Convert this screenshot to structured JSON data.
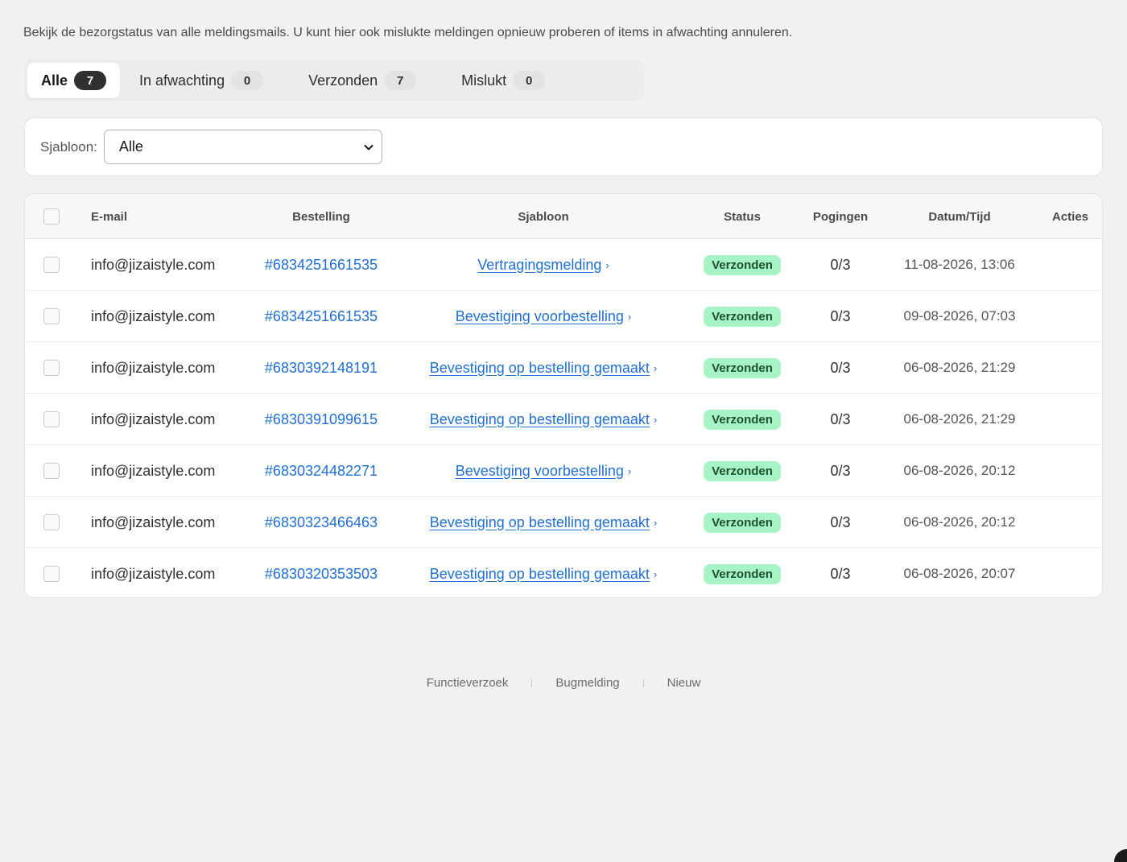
{
  "description": "Bekijk de bezorgstatus van alle meldingsmails. U kunt hier ook mislukte meldingen opnieuw proberen of items in afwachting annuleren.",
  "tabs": [
    {
      "label": "Alle",
      "count": "7",
      "active": true
    },
    {
      "label": "In afwachting",
      "count": "0",
      "active": false
    },
    {
      "label": "Verzonden",
      "count": "7",
      "active": false
    },
    {
      "label": "Mislukt",
      "count": "0",
      "active": false
    }
  ],
  "filter": {
    "label": "Sjabloon:",
    "selected": "Alle"
  },
  "table": {
    "headers": {
      "email": "E-mail",
      "order": "Bestelling",
      "template": "Sjabloon",
      "status": "Status",
      "attempts": "Pogingen",
      "datetime": "Datum/Tijd",
      "actions": "Acties"
    },
    "rows": [
      {
        "email": "info@jizaistyle.com",
        "order": "#6834251661535",
        "template": "Vertragingsmelding",
        "status": "Verzonden",
        "attempts": "0/3",
        "datetime": "11-08-2026, 13:06"
      },
      {
        "email": "info@jizaistyle.com",
        "order": "#6834251661535",
        "template": "Bevestiging voorbestelling",
        "status": "Verzonden",
        "attempts": "0/3",
        "datetime": "09-08-2026, 07:03"
      },
      {
        "email": "info@jizaistyle.com",
        "order": "#6830392148191",
        "template": "Bevestiging op bestelling gemaakt",
        "status": "Verzonden",
        "attempts": "0/3",
        "datetime": "06-08-2026, 21:29"
      },
      {
        "email": "info@jizaistyle.com",
        "order": "#6830391099615",
        "template": "Bevestiging op bestelling gemaakt",
        "status": "Verzonden",
        "attempts": "0/3",
        "datetime": "06-08-2026, 21:29"
      },
      {
        "email": "info@jizaistyle.com",
        "order": "#6830324482271",
        "template": "Bevestiging voorbestelling",
        "status": "Verzonden",
        "attempts": "0/3",
        "datetime": "06-08-2026, 20:12"
      },
      {
        "email": "info@jizaistyle.com",
        "order": "#6830323466463",
        "template": "Bevestiging op bestelling gemaakt",
        "status": "Verzonden",
        "attempts": "0/3",
        "datetime": "06-08-2026, 20:12"
      },
      {
        "email": "info@jizaistyle.com",
        "order": "#6830320353503",
        "template": "Bevestiging op bestelling gemaakt",
        "status": "Verzonden",
        "attempts": "0/3",
        "datetime": "06-08-2026, 20:07"
      }
    ]
  },
  "footer": {
    "links": [
      "Functieverzoek",
      "Bugmelding",
      "Nieuw"
    ]
  },
  "colors": {
    "link": "#1f6fd1",
    "badge_bg": "#a7f3c5",
    "badge_text": "#1d4f33",
    "active_count_bg": "#303030"
  },
  "icons": {
    "select": "chevron-down-icon",
    "template_link": "chevron-right-icon"
  }
}
